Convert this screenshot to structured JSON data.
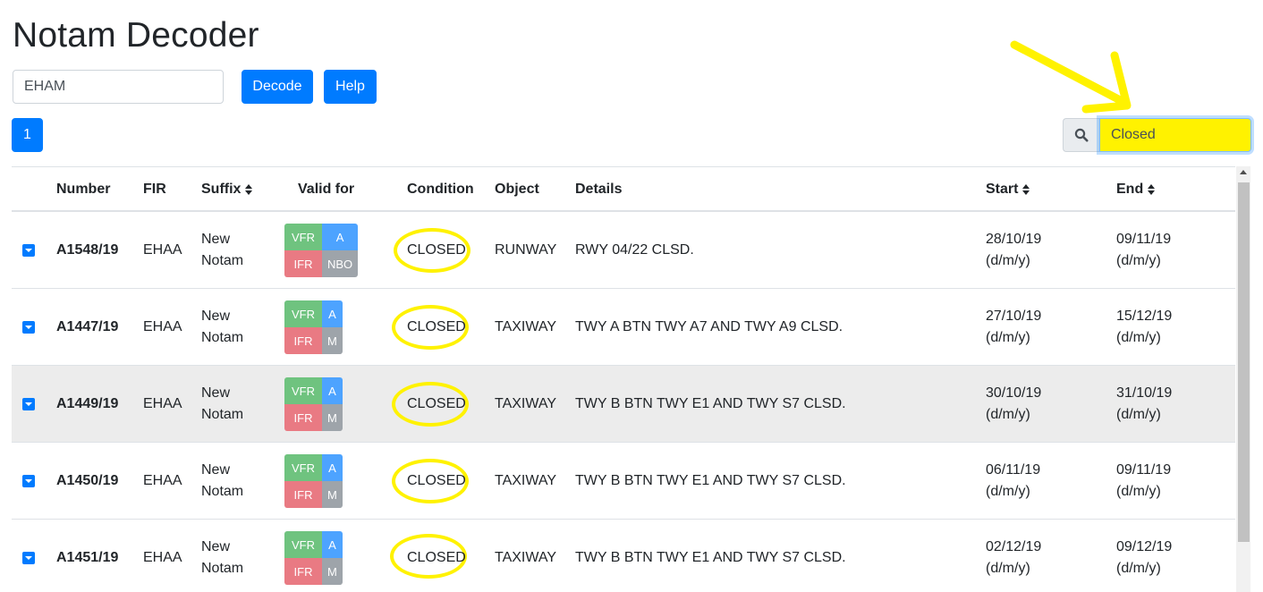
{
  "page": {
    "title": "Notam Decoder"
  },
  "controls": {
    "icao_value": "EHAM",
    "decode_label": "Decode",
    "help_label": "Help",
    "page_label": "1",
    "search_value": "Closed",
    "search_icon": "search-icon"
  },
  "colors": {
    "primary": "#007bff",
    "highlight": "#fff200",
    "vfr": "#6fc37f",
    "ifr": "#e97a83",
    "scope_a": "#4da3ff",
    "scope_other": "#9ea4aa"
  },
  "table": {
    "headers": {
      "number": "Number",
      "fir": "FIR",
      "suffix": "Suffix",
      "valid_for": "Valid for",
      "condition": "Condition",
      "object": "Object",
      "details": "Details",
      "start": "Start",
      "end": "End"
    },
    "rows": [
      {
        "number": "A1548/19",
        "fir": "EHAA",
        "suffix_1": "New",
        "suffix_2": "Notam",
        "vfr": "VFR",
        "ifr": "IFR",
        "scope_1": "A",
        "scope_2": "NBO",
        "condition": "CLOSED",
        "object": "RUNWAY",
        "details": "RWY 04/22 CLSD.",
        "start_date": "28/10/19",
        "start_fmt": "(d/m/y)",
        "end_date": "09/11/19",
        "end_fmt": "(d/m/y)"
      },
      {
        "number": "A1447/19",
        "fir": "EHAA",
        "suffix_1": "New",
        "suffix_2": "Notam",
        "vfr": "VFR",
        "ifr": "IFR",
        "scope_1": "A",
        "scope_2": "M",
        "condition": "CLOSED",
        "object": "TAXIWAY",
        "details": "TWY A BTN TWY A7 AND TWY A9 CLSD.",
        "start_date": "27/10/19",
        "start_fmt": "(d/m/y)",
        "end_date": "15/12/19",
        "end_fmt": "(d/m/y)"
      },
      {
        "number": "A1449/19",
        "fir": "EHAA",
        "suffix_1": "New",
        "suffix_2": "Notam",
        "vfr": "VFR",
        "ifr": "IFR",
        "scope_1": "A",
        "scope_2": "M",
        "condition": "CLOSED",
        "object": "TAXIWAY",
        "details": "TWY B BTN TWY E1 AND TWY S7 CLSD.",
        "start_date": "30/10/19",
        "start_fmt": "(d/m/y)",
        "end_date": "31/10/19",
        "end_fmt": "(d/m/y)"
      },
      {
        "number": "A1450/19",
        "fir": "EHAA",
        "suffix_1": "New",
        "suffix_2": "Notam",
        "vfr": "VFR",
        "ifr": "IFR",
        "scope_1": "A",
        "scope_2": "M",
        "condition": "CLOSED",
        "object": "TAXIWAY",
        "details": "TWY B BTN TWY E1 AND TWY S7 CLSD.",
        "start_date": "06/11/19",
        "start_fmt": "(d/m/y)",
        "end_date": "09/11/19",
        "end_fmt": "(d/m/y)"
      },
      {
        "number": "A1451/19",
        "fir": "EHAA",
        "suffix_1": "New",
        "suffix_2": "Notam",
        "vfr": "VFR",
        "ifr": "IFR",
        "scope_1": "A",
        "scope_2": "M",
        "condition": "CLOSED",
        "object": "TAXIWAY",
        "details": "TWY B BTN TWY E1 AND TWY S7 CLSD.",
        "start_date": "02/12/19",
        "start_fmt": "(d/m/y)",
        "end_date": "09/12/19",
        "end_fmt": "(d/m/y)"
      }
    ]
  }
}
